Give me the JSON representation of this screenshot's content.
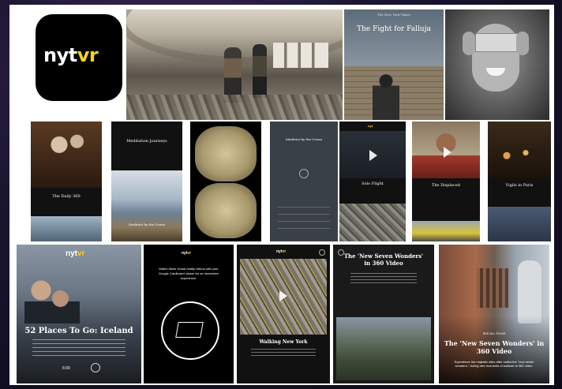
{
  "brand": {
    "app_logo_text": "nytvr",
    "logo_prefix": "nyt",
    "logo_suffix": "vr",
    "accent": "#ffd21a",
    "bg": "#000000"
  },
  "banner": {
    "headline": "The Fight for Falluja",
    "masthead": "The New York Times"
  },
  "phones": {
    "daily360": {
      "title": "The Daily 360"
    },
    "meditation": {
      "title": "Meditation Journeys",
      "subtitle": "Meditate by the Ocean"
    },
    "meditate_ocean": {
      "title": "Meditate by the Ocean"
    },
    "solo_flight": {
      "title": "Solo Flight"
    },
    "displaced": {
      "title": "The Displaced"
    },
    "vigils_paris": {
      "title": "Vigils in Paris"
    }
  },
  "bottom": {
    "iceland": {
      "logo": "nytvr",
      "title": "52 Places To Go: Iceland",
      "time": "6:00"
    },
    "cardboard": {
      "logo": "nytvr",
      "text": "Watch these virtual reality videos with your Google Cardboard viewer for an immersive experience."
    },
    "walking": {
      "logo": "nytvr",
      "title": "Walking New York"
    },
    "seven_wonders_phone": {
      "title": "The 'New Seven Wonders' in 360 Video"
    },
    "seven_wonders_poster": {
      "see_all": "SEE ALL FILMS",
      "title": "The 'New Seven Wonders' in 360 Video",
      "text": "Experience the majestic sites after called the \"new seven wonders,\" during rare moments of solitude in 360 video."
    }
  }
}
